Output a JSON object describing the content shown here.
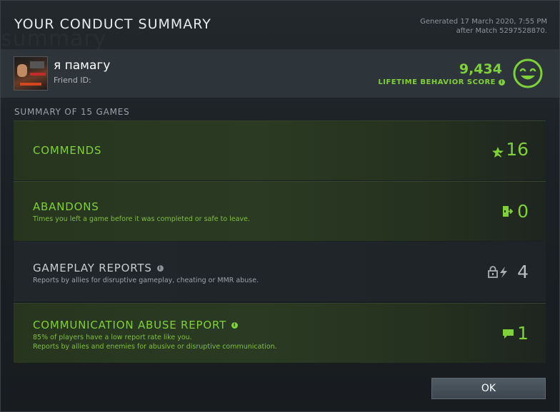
{
  "dialog": {
    "title": "YOUR CONDUCT SUMMARY",
    "generated_line1": "Generated 17 March 2020, 7:55 PM",
    "generated_line2": "after Match 5297528870."
  },
  "profile": {
    "username": "я памагу",
    "friend_id_label": "Friend ID:",
    "behavior_score": "9,434",
    "behavior_score_label": "LIFETIME BEHAVIOR SCORE",
    "smile_icon": "smile-face-icon",
    "accent_color": "#7ed13a"
  },
  "summary": {
    "header": "SUMMARY OF 15 GAMES"
  },
  "stats": [
    {
      "title": "COMMENDS",
      "description": "",
      "value": "16",
      "icon": "star-icon",
      "style": "positive"
    },
    {
      "title": "ABANDONS",
      "description": "Times you left a game before it was completed or safe to leave.",
      "value": "0",
      "icon": "exit-door-icon",
      "style": "positive"
    },
    {
      "title": "GAMEPLAY REPORTS",
      "description": "Reports by allies for disruptive gameplay, cheating or MMR abuse.",
      "value": "4",
      "icon": "lock-lightning-icon",
      "style": "neutral"
    },
    {
      "title": "COMMUNICATION ABUSE REPORT",
      "description_line1": "85% of players have a low report rate like you.",
      "description_line2": "Reports by allies and enemies for abusive or disruptive communication.",
      "value": "1",
      "icon": "chat-bubble-icon",
      "style": "positive"
    }
  ],
  "actions": {
    "ok_label": "OK"
  }
}
